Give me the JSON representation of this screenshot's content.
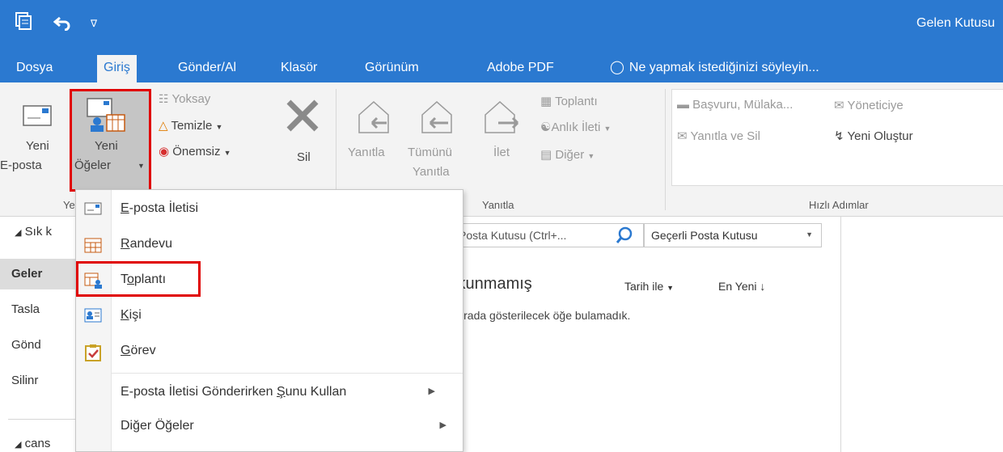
{
  "titlebar": {
    "title": "Gelen Kutusu"
  },
  "tabs": [
    {
      "label": "Dosya"
    },
    {
      "label": "Giriş"
    },
    {
      "label": "Gönder/Al"
    },
    {
      "label": "Klasör"
    },
    {
      "label": "Görünüm"
    },
    {
      "label": "Adobe PDF"
    }
  ],
  "tell_me": "Ne yapmak istediğinizi söyleyin...",
  "ribbon": {
    "new_email_line1": "Yeni",
    "new_email_line2": "E-posta",
    "new_items_line1": "Yeni",
    "new_items_line2": "Öğeler",
    "group_new_partial": "Ye",
    "ignore": "Yoksay",
    "cleanup": "Temizle",
    "junk": "Önemsiz",
    "delete": "Sil",
    "reply": "Yanıtla",
    "reply_all_line1": "Tümünü",
    "reply_all_line2": "Yanıtla",
    "forward": "İlet",
    "meeting": "Toplantı",
    "im": "Anlık İleti",
    "more": "Diğer",
    "group_respond": "Yanıtla",
    "qs_1": "Başvuru, Mülaka...",
    "qs_2": "Yöneticiye",
    "qs_3": "Yanıtla ve Sil",
    "qs_4": "Yeni Oluştur",
    "group_quicksteps": "Hızlı Adımlar"
  },
  "leftpane": {
    "items": [
      "Sık k",
      "Geler",
      "Tasla",
      "Gönd",
      "Silinr",
      "cans"
    ]
  },
  "midpane": {
    "search_placeholder": "Posta Kutusu (Ctrl+...",
    "scope": "Geçerli Posta Kutusu",
    "filter": "Okunmamış",
    "sort_by": "Tarih ile",
    "order": "En Yeni",
    "empty_message": "Burada gösterilecek öğe bulamadık."
  },
  "menu": {
    "items": [
      {
        "prefix": "",
        "u": "E",
        "suffix": "-posta İletisi"
      },
      {
        "prefix": "",
        "u": "R",
        "suffix": "andevu"
      },
      {
        "prefix": "T",
        "u": "o",
        "suffix": "plantı"
      },
      {
        "prefix": "",
        "u": "K",
        "suffix": "işi"
      },
      {
        "prefix": "",
        "u": "G",
        "suffix": "örev"
      },
      {
        "prefix": "E-posta İletisi Gönderirken ",
        "u": "Ş",
        "suffix": "unu Kullan"
      },
      {
        "prefix": "Di",
        "u": "ğ",
        "suffix": "er Öğeler"
      }
    ]
  },
  "colors": {
    "accent": "#2b79d0",
    "highlight": "#e00000"
  }
}
